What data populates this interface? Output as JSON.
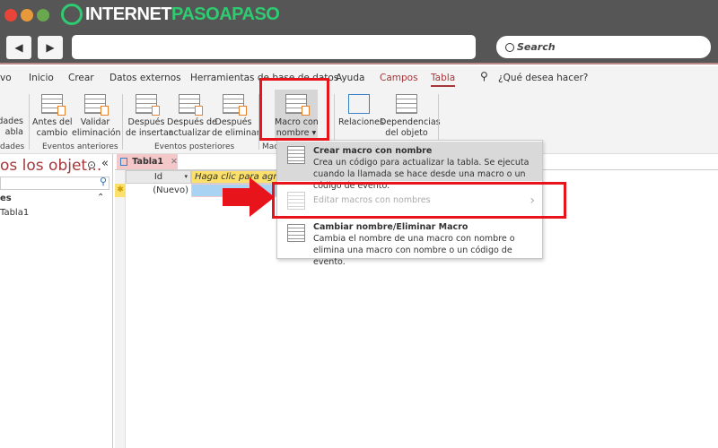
{
  "browser": {
    "logo_text_a": "INTERNET",
    "logo_text_b": "PASOAPASO",
    "search_placeholder": "Search",
    "back": "◀",
    "forward": "▶"
  },
  "tabs": [
    {
      "label": "vo"
    },
    {
      "label": "Inicio"
    },
    {
      "label": "Crear"
    },
    {
      "label": "Datos externos"
    },
    {
      "label": "Herramientas de base de datos"
    },
    {
      "label": "Ayuda"
    },
    {
      "label": "Campos"
    },
    {
      "label": "Tabla",
      "active": true
    }
  ],
  "tell_me": "¿Qué desea hacer?",
  "ribbon": {
    "partial": {
      "line1": "dades",
      "line2": "abla",
      "group": "dades"
    },
    "antes_cambio": "Antes del\ncambio",
    "validar": "Validar\neliminación",
    "g_anteriores": "Eventos anteriores",
    "desp_insertar": "Después\nde insertar",
    "desp_actualizar": "Después de\nactualizar",
    "desp_eliminar": "Después\nde eliminar",
    "g_posteriores": "Eventos posteriores",
    "macro": "Macro con\nnombre ▾",
    "g_macro": "Mac",
    "relaciones": "Relaciones",
    "dependencias": "Dependencias\ndel objeto"
  },
  "navpane": {
    "title": "os los objet...",
    "section": "es",
    "items": [
      "Tabla1"
    ]
  },
  "doc": {
    "tab": "Tabla1",
    "columns": [
      "Id",
      "Haga clic para agregar"
    ],
    "new_row": "(Nuevo)",
    "new_marker": "✱"
  },
  "menu": {
    "items": [
      {
        "title": "Crear macro con nombre",
        "desc": "Crea un código para actualizar la tabla. Se ejecuta cuando la llamada se hace desde una macro o un código de evento.",
        "state": "hover"
      },
      {
        "title": "Editar macros con nombres",
        "desc": "",
        "state": "disabled",
        "submenu": "›"
      },
      {
        "title": "Cambiar nombre/Eliminar Macro",
        "desc": "Cambia el nombre de una macro con nombre o elimina una macro con nombre o un código de evento.",
        "state": "normal"
      }
    ]
  },
  "colors": {
    "accent": "#a4373a",
    "highlight": "#e8141c",
    "logo_green": "#2ecc71"
  }
}
